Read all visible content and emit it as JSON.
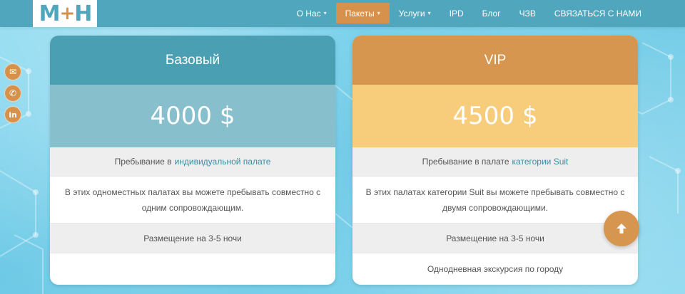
{
  "logo": {
    "left": "М",
    "plus": "+",
    "right": "Н"
  },
  "nav": [
    {
      "label": "О Нас",
      "caret": true
    },
    {
      "label": "Пакеты",
      "caret": true,
      "active": true
    },
    {
      "label": "Услуги",
      "caret": true
    },
    {
      "label": "IPD",
      "caret": false
    },
    {
      "label": "Блог",
      "caret": false
    },
    {
      "label": "ЧЗВ",
      "caret": false
    },
    {
      "label": "СВЯЗАТЬСЯ С НАМИ",
      "caret": false
    }
  ],
  "social": [
    {
      "icon": "envelope-icon",
      "glyph": "✉"
    },
    {
      "icon": "phone-icon",
      "glyph": "✆"
    },
    {
      "icon": "linkedin-icon",
      "glyph": "in"
    }
  ],
  "cards": {
    "basic": {
      "title": "Базовый",
      "price": "4000 $",
      "row1_text": "Пребывание в",
      "row1_link": "индивидуальной палате",
      "row2": "В этих одноместных палатах вы можете пребывать совместно с одним сопровождающим.",
      "row3": "Размещение на 3-5 ночи",
      "row4": ""
    },
    "vip": {
      "title": "VIP",
      "price": "4500 $",
      "row1_text": "Пребывание в палате",
      "row1_link": "категории Suit",
      "row2": "В этих палатах категории Suit вы можете пребывать совместно с двумя сопровождающими.",
      "row3": "Размещение на 3-5 ночи",
      "row4": "Однодневная экскурсия по городу"
    }
  },
  "scroll_top": {
    "glyph": "🡑"
  },
  "colors": {
    "teal": "#4a9fb2",
    "orange": "#d6964f",
    "gold": "#f7cd7c"
  }
}
